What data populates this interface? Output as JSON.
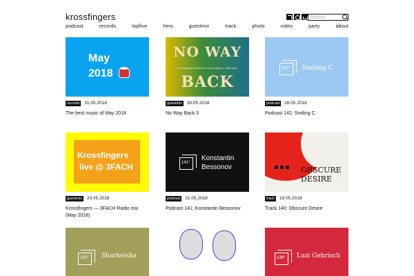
{
  "header": {
    "brand": "krossfingers",
    "social_icons": [
      "soundcloud-icon",
      "instagram-icon",
      "mixcloud-icon"
    ],
    "search_placeholder": "Search"
  },
  "nav": [
    "podcast",
    "records",
    "topfive",
    "hero",
    "guestmix",
    "track",
    "photo",
    "video",
    "party",
    "about"
  ],
  "cards": [
    {
      "tag": "records",
      "date": "31.05.2018",
      "title": "The best music of May 2018",
      "thumb_text": [
        "May",
        "2018"
      ]
    },
    {
      "tag": "guestmix",
      "date": "30.05.2018",
      "title": "No Way Back 5",
      "thumb_text": [
        "NO WAY",
        "Krossfingers rediscover Rara classics. Stars jazz",
        "BACK"
      ]
    },
    {
      "tag": "podcast",
      "date": "28.05.2018",
      "title": "Podcast 142: Smiling C",
      "thumb_text": [
        "142°",
        "Smiling C"
      ]
    },
    {
      "tag": "guestmix",
      "date": "23.05.2018",
      "title": "Krossfingers — 3FACH Radio mix (May 2018)",
      "thumb_text": [
        "Krossfingers",
        "live @ 3FACH"
      ]
    },
    {
      "tag": "podcast",
      "date": "21.05.2018",
      "title": "Podcast 141: Konstantin Bessonov",
      "thumb_text": [
        "141°",
        "Konstantin",
        "Bessonov"
      ]
    },
    {
      "tag": "track",
      "date": "18.05.2018",
      "title": "Track 140: Obscure Desire",
      "thumb_text": [
        "OBSCURE",
        "DESIRE"
      ]
    },
    {
      "thumb_text": [
        "140°",
        "Sharkeisha"
      ]
    },
    {
      "thumb_text": []
    },
    {
      "thumb_text": [
        "139°",
        "Luzi Gehrisch"
      ]
    }
  ]
}
